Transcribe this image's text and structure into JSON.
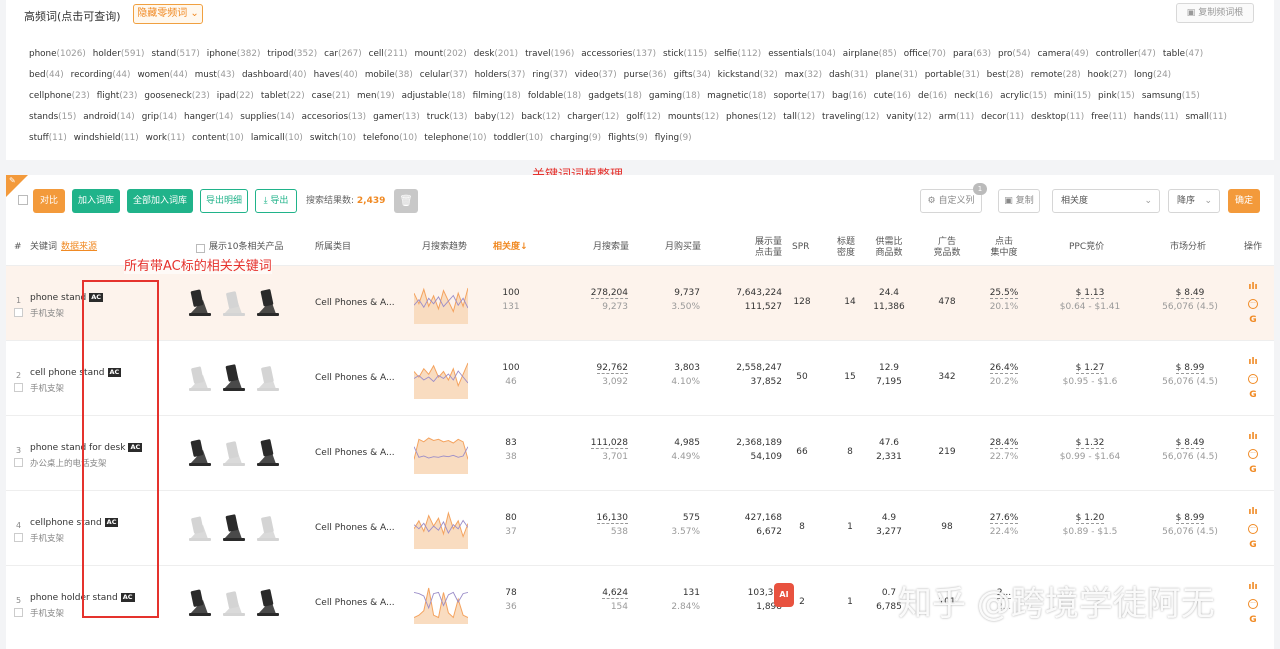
{
  "kw_panel": {
    "title": "高频词(点击可查询)",
    "hide_button": "隐藏零频词",
    "copy_button": "复制频词根",
    "rows": [
      [
        [
          "phone",
          "1026"
        ],
        [
          "holder",
          "591"
        ],
        [
          "stand",
          "517"
        ],
        [
          "iphone",
          "382"
        ],
        [
          "tripod",
          "352"
        ],
        [
          "car",
          "267"
        ],
        [
          "cell",
          "211"
        ],
        [
          "mount",
          "202"
        ],
        [
          "desk",
          "201"
        ],
        [
          "travel",
          "196"
        ],
        [
          "accessories",
          "137"
        ],
        [
          "stick",
          "115"
        ],
        [
          "selfie",
          "112"
        ],
        [
          "essentials",
          "104"
        ],
        [
          "airplane",
          "85"
        ],
        [
          "office",
          "70"
        ],
        [
          "para",
          "63"
        ],
        [
          "pro",
          "54"
        ],
        [
          "camera",
          "49"
        ],
        [
          "controller",
          "47"
        ],
        [
          "table",
          "47"
        ]
      ],
      [
        [
          "bed",
          "44"
        ],
        [
          "recording",
          "44"
        ],
        [
          "women",
          "44"
        ],
        [
          "must",
          "43"
        ],
        [
          "dashboard",
          "40"
        ],
        [
          "haves",
          "40"
        ],
        [
          "mobile",
          "38"
        ],
        [
          "celular",
          "37"
        ],
        [
          "holders",
          "37"
        ],
        [
          "ring",
          "37"
        ],
        [
          "video",
          "37"
        ],
        [
          "purse",
          "36"
        ],
        [
          "gifts",
          "34"
        ],
        [
          "kickstand",
          "32"
        ],
        [
          "max",
          "32"
        ],
        [
          "dash",
          "31"
        ],
        [
          "plane",
          "31"
        ],
        [
          "portable",
          "31"
        ],
        [
          "best",
          "28"
        ],
        [
          "remote",
          "28"
        ],
        [
          "hook",
          "27"
        ],
        [
          "long",
          "24"
        ]
      ],
      [
        [
          "cellphone",
          "23"
        ],
        [
          "flight",
          "23"
        ],
        [
          "gooseneck",
          "23"
        ],
        [
          "ipad",
          "22"
        ],
        [
          "tablet",
          "22"
        ],
        [
          "case",
          "21"
        ],
        [
          "men",
          "19"
        ],
        [
          "adjustable",
          "18"
        ],
        [
          "filming",
          "18"
        ],
        [
          "foldable",
          "18"
        ],
        [
          "gadgets",
          "18"
        ],
        [
          "gaming",
          "18"
        ],
        [
          "magnetic",
          "18"
        ],
        [
          "soporte",
          "17"
        ],
        [
          "bag",
          "16"
        ],
        [
          "cute",
          "16"
        ],
        [
          "de",
          "16"
        ],
        [
          "neck",
          "16"
        ],
        [
          "acrylic",
          "15"
        ],
        [
          "mini",
          "15"
        ],
        [
          "pink",
          "15"
        ],
        [
          "samsung",
          "15"
        ]
      ],
      [
        [
          "stands",
          "15"
        ],
        [
          "android",
          "14"
        ],
        [
          "grip",
          "14"
        ],
        [
          "hanger",
          "14"
        ],
        [
          "supplies",
          "14"
        ],
        [
          "accesorios",
          "13"
        ],
        [
          "gamer",
          "13"
        ],
        [
          "truck",
          "13"
        ],
        [
          "baby",
          "12"
        ],
        [
          "back",
          "12"
        ],
        [
          "charger",
          "12"
        ],
        [
          "golf",
          "12"
        ],
        [
          "mounts",
          "12"
        ],
        [
          "phones",
          "12"
        ],
        [
          "tall",
          "12"
        ],
        [
          "traveling",
          "12"
        ],
        [
          "vanity",
          "12"
        ],
        [
          "arm",
          "11"
        ],
        [
          "decor",
          "11"
        ],
        [
          "desktop",
          "11"
        ],
        [
          "free",
          "11"
        ],
        [
          "hands",
          "11"
        ],
        [
          "small",
          "11"
        ]
      ],
      [
        [
          "stuff",
          "11"
        ],
        [
          "windshield",
          "11"
        ],
        [
          "work",
          "11"
        ],
        [
          "content",
          "10"
        ],
        [
          "lamicall",
          "10"
        ],
        [
          "switch",
          "10"
        ],
        [
          "telefono",
          "10"
        ],
        [
          "telephone",
          "10"
        ],
        [
          "toddler",
          "10"
        ],
        [
          "charging",
          "9"
        ],
        [
          "flights",
          "9"
        ],
        [
          "flying",
          "9"
        ]
      ]
    ]
  },
  "annotations": {
    "title": "关键词词根整理",
    "ac_note": "所有带AC标的相关关键词"
  },
  "toolbar": {
    "compare": "对比",
    "add_lib": "加入词库",
    "add_all_lib": "全部加入词库",
    "export_detail": "导出明细",
    "export": "导出",
    "result_label": "搜索结果数:",
    "result_count": "2,439",
    "custom_columns": "自定义列",
    "custom_badge": "1",
    "copy": "复制",
    "sort_field": "相关度",
    "sort_order": "降序",
    "confirm": "确定"
  },
  "columns": {
    "idx": "#",
    "keyword": "关键词",
    "data_source": "数据来源",
    "top10": "展示10条相关产品",
    "category": "所属类目",
    "trend": "月搜索趋势",
    "relevance": "相关度↓",
    "monthly_search": "月搜索量",
    "monthly_purchase": "月购买量",
    "impressions_1": "展示量",
    "impressions_2": "点击量",
    "spr": "SPR",
    "title_density_1": "标题",
    "title_density_2": "密度",
    "supply_ratio_1": "供需比",
    "supply_ratio_2": "商品数",
    "ads_1": "广告",
    "ads_2": "竞品数",
    "click_conc_1": "点击",
    "click_conc_2": "集中度",
    "ppc": "PPC竞价",
    "market": "市场分析",
    "ops": "操作"
  },
  "rows": [
    {
      "idx": "1",
      "keyword": "phone stand",
      "ac": "AC",
      "cn": "手机支架",
      "category": "Cell Phones & A...",
      "rel": "100",
      "rel_sub": "131",
      "search": "278,204",
      "search_sub": "9,273",
      "purchase": "9,737",
      "purchase_sub": "3.50%",
      "imp": "7,643,224",
      "clicks": "111,527",
      "spr": "128",
      "density": "14",
      "supply": "24.4",
      "products": "11,386",
      "ads": "478",
      "conc": "25.5%",
      "conc_sub": "20.1%",
      "ppc": "$ 1.13",
      "ppc_range": "$0.64 - $1.41",
      "price": "$ 8.49",
      "price_sub": "56,076 (4.5)",
      "trend": [
        22,
        14,
        25,
        12,
        20,
        10,
        24,
        16,
        8,
        22,
        12,
        26
      ]
    },
    {
      "idx": "2",
      "keyword": "cell phone stand",
      "ac": "AC",
      "cn": "手机支架",
      "category": "Cell Phones & A...",
      "rel": "100",
      "rel_sub": "46",
      "search": "92,762",
      "search_sub": "3,092",
      "purchase": "3,803",
      "purchase_sub": "4.10%",
      "imp": "2,558,247",
      "clicks": "37,852",
      "spr": "50",
      "density": "15",
      "supply": "12.9",
      "products": "7,195",
      "ads": "342",
      "conc": "26.4%",
      "conc_sub": "20.2%",
      "ppc": "$ 1.27",
      "ppc_range": "$0.95 - $1.6",
      "price": "$ 8.99",
      "price_sub": "56,076 (4.5)",
      "trend": [
        18,
        14,
        20,
        16,
        22,
        14,
        18,
        12,
        20,
        8,
        16,
        24
      ]
    },
    {
      "idx": "3",
      "keyword": "phone stand for desk",
      "ac": "AC",
      "cn": "办公桌上的电话支架",
      "category": "Cell Phones & A...",
      "rel": "83",
      "rel_sub": "38",
      "search": "111,028",
      "search_sub": "3,701",
      "purchase": "4,985",
      "purchase_sub": "4.49%",
      "imp": "2,368,189",
      "clicks": "54,109",
      "spr": "66",
      "density": "8",
      "supply": "47.6",
      "products": "2,331",
      "ads": "219",
      "conc": "28.4%",
      "conc_sub": "22.7%",
      "ppc": "$ 1.32",
      "ppc_range": "$0.99 - $1.64",
      "price": "$ 8.49",
      "price_sub": "56,076 (4.5)",
      "trend": [
        10,
        26,
        24,
        27,
        25,
        26,
        24,
        25,
        23,
        26,
        24,
        10
      ]
    },
    {
      "idx": "4",
      "keyword": "cellphone stand",
      "ac": "AC",
      "cn": "手机支架",
      "category": "Cell Phones & A...",
      "rel": "80",
      "rel_sub": "37",
      "search": "16,130",
      "search_sub": "538",
      "purchase": "575",
      "purchase_sub": "3.57%",
      "imp": "427,168",
      "clicks": "6,672",
      "spr": "8",
      "density": "1",
      "supply": "4.9",
      "products": "3,277",
      "ads": "98",
      "conc": "27.6%",
      "conc_sub": "22.4%",
      "ppc": "$ 1.20",
      "ppc_range": "$0.89 - $1.5",
      "price": "$ 8.99",
      "price_sub": "56,076 (4.5)",
      "trend": [
        14,
        20,
        12,
        24,
        16,
        22,
        10,
        26,
        14,
        20,
        8,
        18
      ]
    },
    {
      "idx": "5",
      "keyword": "phone holder stand",
      "ac": "AC",
      "cn": "手机支架",
      "category": "Cell Phones & A...",
      "rel": "78",
      "rel_sub": "36",
      "search": "4,624",
      "search_sub": "154",
      "purchase": "131",
      "purchase_sub": "2.84%",
      "imp": "103,3...",
      "clicks": "1,898",
      "spr": "2",
      "density": "1",
      "supply": "0.7",
      "products": "6,785",
      "ads": "101",
      "conc": "2...",
      "conc_sub": "2...",
      "ppc": "",
      "ppc_range": "",
      "price": "",
      "price_sub": "",
      "trend": [
        4,
        6,
        10,
        30,
        6,
        4,
        26,
        8,
        4,
        20,
        6,
        4
      ]
    }
  ],
  "ai_badge": "AI",
  "watermark": "知乎 @跨境学徒阿无",
  "colors": {
    "accent": "#f39a3b",
    "green": "#20b38a",
    "red_annot": "#e5322d",
    "trend_fill": "#f9dcc0",
    "trend_line1": "#9b8dc8",
    "trend_line2": "#f4a35f"
  }
}
